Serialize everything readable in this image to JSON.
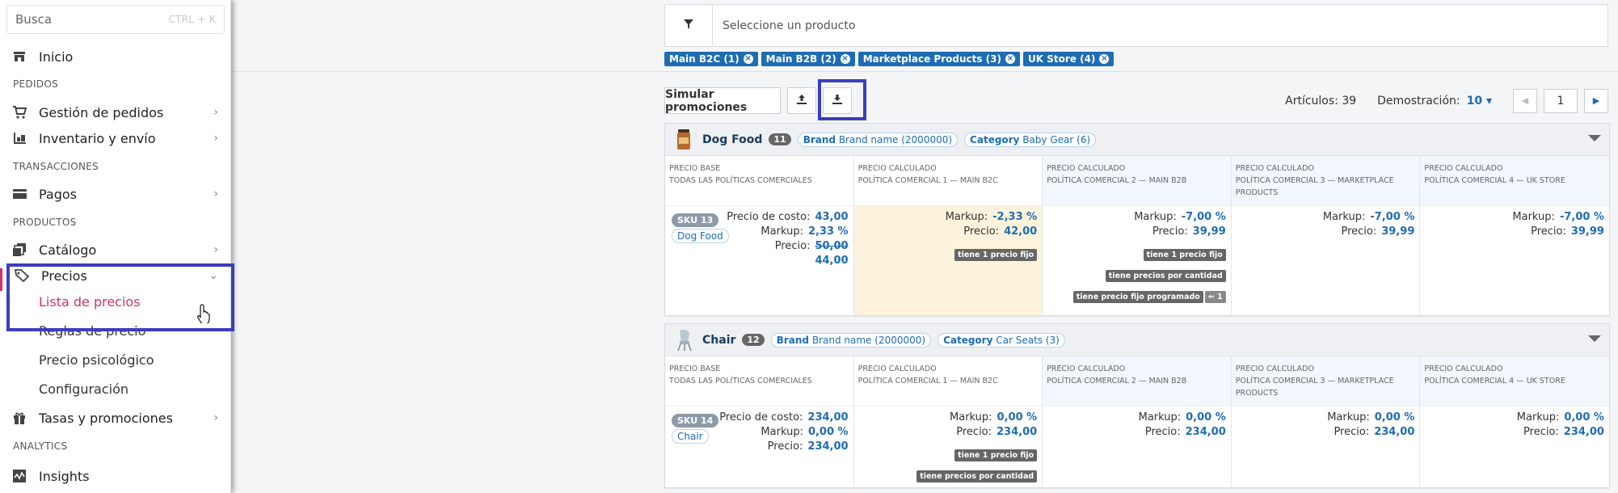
{
  "search": {
    "placeholder": "Busca",
    "shortcut": "CTRL + K"
  },
  "nav": {
    "inicio": "Inicio",
    "sec_pedidos": "PEDIDOS",
    "gestion": "Gestión de pedidos",
    "inventario": "Inventario y envío",
    "sec_transacciones": "TRANSACCIONES",
    "pagos": "Pagos",
    "sec_productos": "PRODUCTOS",
    "catalogo": "Catálogo",
    "precios": "Precios",
    "sub": [
      "Lista de precios",
      "Reglas de precio",
      "Precio psicológico",
      "Configuración"
    ],
    "tasas": "Tasas y promociones",
    "sec_analytics": "ANALYTICS",
    "insights": "Insights"
  },
  "filter": {
    "placeholder": "Seleccione un producto"
  },
  "chips": [
    "Main B2C (1)",
    "Main B2B (2)",
    "Marketplace Products (3)",
    "UK Store (4)"
  ],
  "toolbar": {
    "simulate": "Simular promociones"
  },
  "pager": {
    "articles": "Artículos: 39",
    "display_label": "Demostración:",
    "display_value": "10",
    "page": "1"
  },
  "col_headers": [
    {
      "l1": "PRECIO BASE",
      "l2": "TODAS LAS POLÍTICAS COMERCIALES"
    },
    {
      "l1": "PRECIO CALCULADO",
      "l2": "POLÍTICA COMERCIAL 1 — MAIN B2C"
    },
    {
      "l1": "PRECIO CALCULADO",
      "l2": "POLÍTICA COMERCIAL 2 — MAIN B2B"
    },
    {
      "l1": "PRECIO CALCULADO",
      "l2": "POLÍTICA COMERCIAL 3 — MARKETPLACE PRODUCTS"
    },
    {
      "l1": "PRECIO CALCULADO",
      "l2": "POLÍTICA COMERCIAL 4 — UK STORE"
    }
  ],
  "labels": {
    "cost": "Precio de costo:",
    "markup": "Markup:",
    "price": "Precio:",
    "brand_key": "Brand",
    "category_key": "Category"
  },
  "products": [
    {
      "name": "Dog Food",
      "count": "11",
      "brand": "Brand name (2000000)",
      "category": "Baby Gear (6)",
      "sku": "SKU 13",
      "sku_category": "Dog Food",
      "cost": "43,00",
      "markup": "2,33 %",
      "price_old": "50,00",
      "price": "44,00",
      "policies": [
        {
          "markup": "-2,33 %",
          "price": "42,00",
          "tags": [
            "tiene 1 precio fijo"
          ]
        },
        {
          "markup": "-7,00 %",
          "price": "39,99",
          "tags": [
            "tiene 1 precio fijo",
            "tiene precios por cantidad",
            "tiene precio fijo programado"
          ],
          "extra": "1"
        },
        {
          "markup": "-7,00 %",
          "price": "39,99",
          "tags": []
        },
        {
          "markup": "-7,00 %",
          "price": "39,99",
          "tags": []
        }
      ]
    },
    {
      "name": "Chair",
      "count": "12",
      "brand": "Brand name (2000000)",
      "category": "Car Seats (3)",
      "sku": "SKU 14",
      "sku_category": "Chair",
      "cost": "234,00",
      "markup": "0,00 %",
      "price": "234,00",
      "policies": [
        {
          "markup": "0,00 %",
          "price": "234,00",
          "tags": [
            "tiene 1 precio fijo",
            "tiene precios por cantidad"
          ]
        },
        {
          "markup": "0,00 %",
          "price": "234,00",
          "tags": []
        },
        {
          "markup": "0,00 %",
          "price": "234,00",
          "tags": []
        },
        {
          "markup": "0,00 %",
          "price": "234,00",
          "tags": []
        }
      ]
    }
  ],
  "colors": {
    "accent": "#1e6cb3",
    "active": "#d63066",
    "highlight": "#3a3ec0",
    "chip": "#1e6cb3"
  }
}
